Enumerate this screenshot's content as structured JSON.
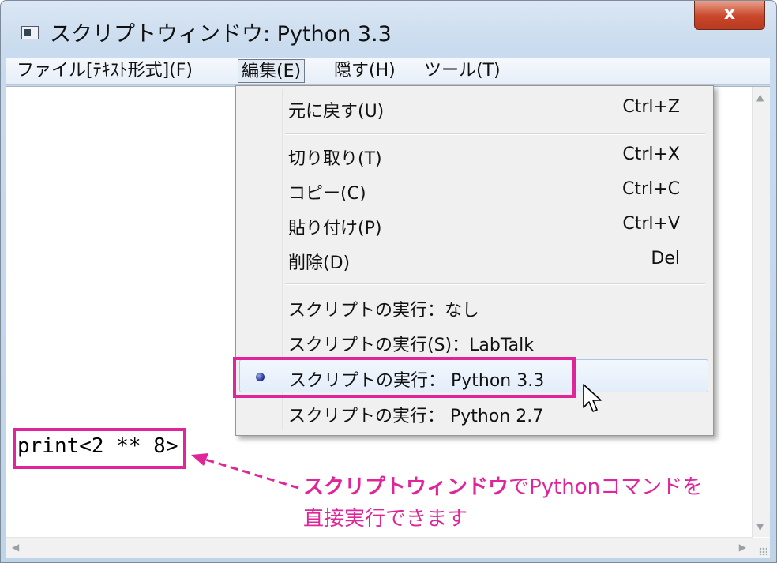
{
  "window": {
    "title": "スクリプトウィンドウ: Python 3.3",
    "close_label": "x"
  },
  "menubar": {
    "items": [
      {
        "label": "ファイル[ﾃｷｽﾄ形式](F)"
      },
      {
        "label": "編集(E)"
      },
      {
        "label": "隠す(H)"
      },
      {
        "label": "ツール(T)"
      }
    ]
  },
  "edit_menu": {
    "undo": {
      "label": "元に戻す(U)",
      "shortcut": "Ctrl+Z"
    },
    "cut": {
      "label": "切り取り(T)",
      "shortcut": "Ctrl+X"
    },
    "copy": {
      "label": "コピー(C)",
      "shortcut": "Ctrl+C"
    },
    "paste": {
      "label": "貼り付け(P)",
      "shortcut": "Ctrl+V"
    },
    "delete": {
      "label": "削除(D)",
      "shortcut": "Del"
    },
    "run_none": {
      "label": "スクリプトの実行：なし"
    },
    "run_labtalk": {
      "label": "スクリプトの実行(S)：LabTalk"
    },
    "run_py33": {
      "label": "スクリプトの実行： Python 3.3",
      "selected": true
    },
    "run_py27": {
      "label": "スクリプトの実行： Python 2.7"
    }
  },
  "editor": {
    "code": "print<2 ** 8>"
  },
  "annotation": {
    "bold_part": "スクリプトウィンドウ",
    "line1_rest": "でPythonコマンドを",
    "line2": "直接実行できます",
    "color": "#e0249a"
  }
}
